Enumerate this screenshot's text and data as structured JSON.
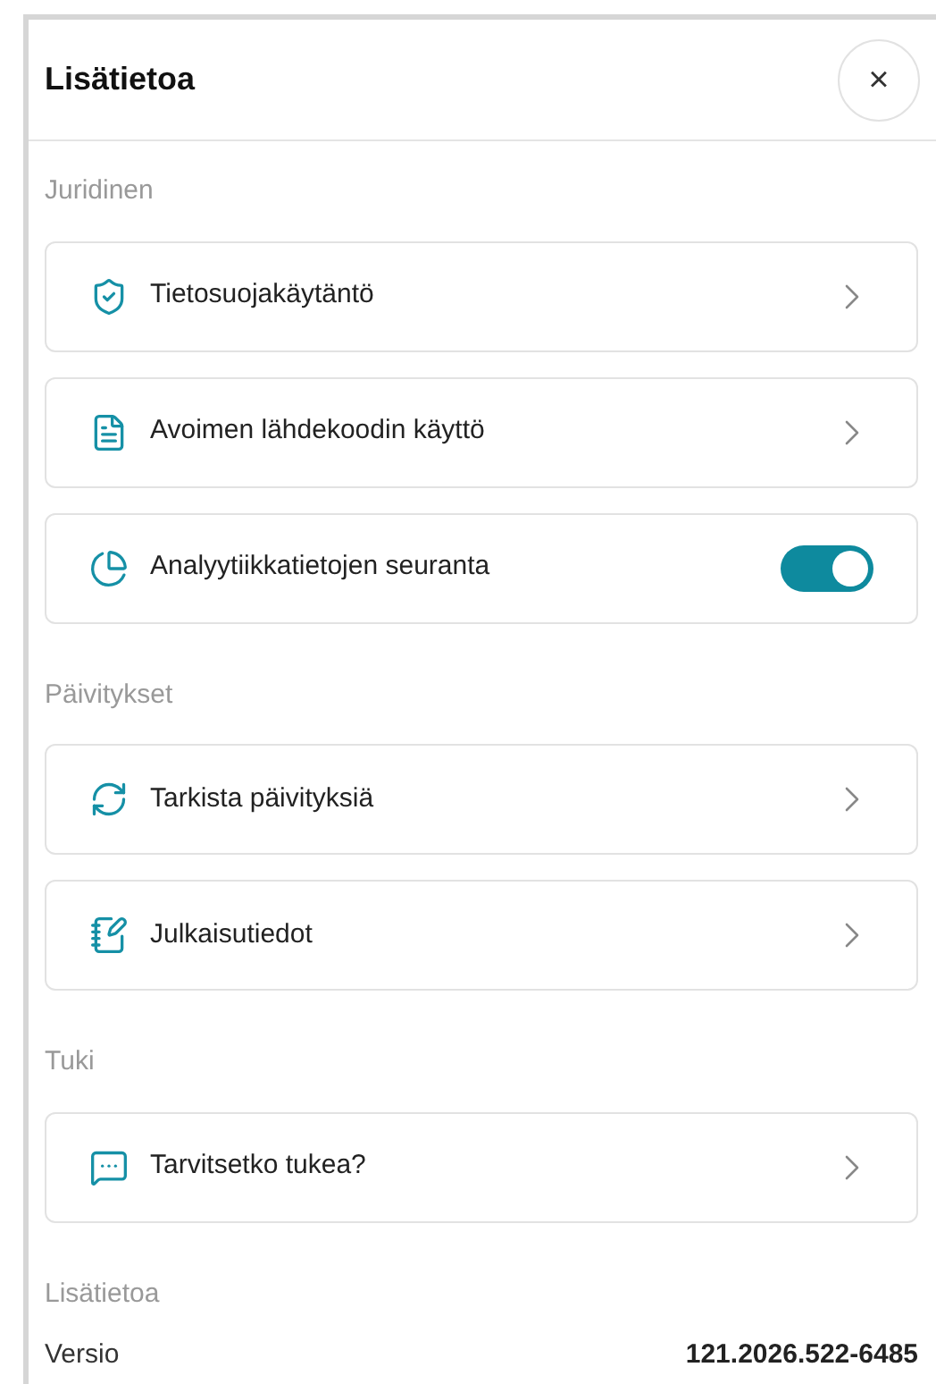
{
  "header": {
    "title": "Lisätietoa",
    "close": "×"
  },
  "sections": [
    {
      "title": "Juridinen",
      "items": [
        {
          "kind": "link",
          "label": "Tietosuojakäytäntö"
        },
        {
          "kind": "link",
          "label": "Avoimen lähdekoodin käyttö"
        },
        {
          "kind": "toggle",
          "label": "Analyytiikkatietojen seuranta",
          "on": true
        }
      ]
    },
    {
      "title": "Päivitykset",
      "items": [
        {
          "kind": "link",
          "label": "Tarkista päivityksiä"
        },
        {
          "kind": "link",
          "label": "Julkaisutiedot"
        }
      ]
    },
    {
      "title": "Tuki",
      "items": [
        {
          "kind": "link",
          "label": "Tarvitsetko tukea?"
        }
      ]
    }
  ],
  "info": {
    "title": "Lisätietoa",
    "label": "Versio",
    "value": "121.2026.522-6485"
  }
}
